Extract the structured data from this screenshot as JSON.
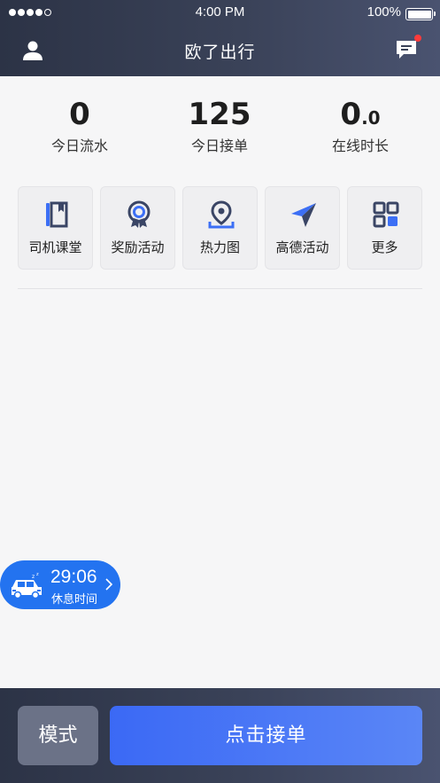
{
  "status_bar": {
    "time": "4:00 PM",
    "battery_percent": "100%",
    "battery_level": 1.0,
    "signal_bars_filled": 4,
    "signal_bars_total": 5
  },
  "nav": {
    "title": "欧了出行",
    "left_icon": "user-icon",
    "right_icon": "message-icon",
    "has_unread_badge": true
  },
  "stats": [
    {
      "value_main": "0",
      "value_small": "",
      "label": "今日流水"
    },
    {
      "value_main": "125",
      "value_small": "",
      "label": "今日接单"
    },
    {
      "value_main": "0",
      "value_small": ".0",
      "label": "在线时长"
    }
  ],
  "tiles": [
    {
      "label": "司机课堂",
      "icon": "notebook-icon"
    },
    {
      "label": "奖励活动",
      "icon": "medal-icon"
    },
    {
      "label": "热力图",
      "icon": "location-pin-icon"
    },
    {
      "label": "高德活动",
      "icon": "paper-plane-icon"
    },
    {
      "label": "更多",
      "icon": "grid-icon"
    }
  ],
  "rest": {
    "time": "29:06",
    "label": "休息时间",
    "icon": "sleeping-car-icon"
  },
  "bottom": {
    "mode_label": "模式",
    "accept_label": "点击接单"
  },
  "colors": {
    "header_start": "#2c3346",
    "header_end": "#4a5370",
    "accent_blue": "#3b69f5",
    "rest_blue": "#2373f0",
    "icon_dark": "#3a4565",
    "icon_blue": "#3c6ff5",
    "badge_red": "#ff3b3b"
  }
}
